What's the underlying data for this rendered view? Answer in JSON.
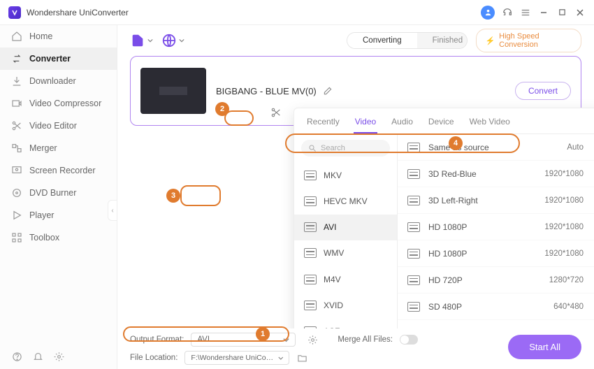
{
  "app": {
    "title": "Wondershare UniConverter"
  },
  "titlebar_icons": {
    "avatar": "user-icon",
    "headset": "support-icon",
    "menu": "menu-icon",
    "min": "minimize-icon",
    "max": "maximize-icon",
    "close": "close-icon"
  },
  "sidebar": {
    "items": [
      {
        "label": "Home",
        "name": "sidebar-item-home"
      },
      {
        "label": "Converter",
        "name": "sidebar-item-converter",
        "active": true
      },
      {
        "label": "Downloader",
        "name": "sidebar-item-downloader"
      },
      {
        "label": "Video Compressor",
        "name": "sidebar-item-video-compressor"
      },
      {
        "label": "Video Editor",
        "name": "sidebar-item-video-editor"
      },
      {
        "label": "Merger",
        "name": "sidebar-item-merger"
      },
      {
        "label": "Screen Recorder",
        "name": "sidebar-item-screen-recorder"
      },
      {
        "label": "DVD Burner",
        "name": "sidebar-item-dvd-burner"
      },
      {
        "label": "Player",
        "name": "sidebar-item-player"
      },
      {
        "label": "Toolbox",
        "name": "sidebar-item-toolbox"
      }
    ]
  },
  "toolbar": {
    "segmented": {
      "converting": "Converting",
      "finished": "Finished"
    },
    "high_speed": "High Speed Conversion"
  },
  "file": {
    "name": "BIGBANG - BLUE MV(0)",
    "convert_label": "Convert"
  },
  "popup": {
    "tabs": {
      "recently": "Recently",
      "video": "Video",
      "audio": "Audio",
      "device": "Device",
      "web": "Web Video"
    },
    "search_placeholder": "Search",
    "formats": [
      "MKV",
      "HEVC MKV",
      "AVI",
      "WMV",
      "M4V",
      "XVID",
      "ASF"
    ],
    "active_format_index": 2,
    "presets": [
      {
        "label": "Same as source",
        "res": "Auto"
      },
      {
        "label": "3D Red-Blue",
        "res": "1920*1080"
      },
      {
        "label": "3D Left-Right",
        "res": "1920*1080"
      },
      {
        "label": "HD 1080P",
        "res": "1920*1080"
      },
      {
        "label": "HD 1080P",
        "res": "1920*1080"
      },
      {
        "label": "HD 720P",
        "res": "1280*720"
      },
      {
        "label": "SD 480P",
        "res": "640*480"
      }
    ]
  },
  "footer": {
    "output_format_label": "Output Format:",
    "output_format_value": "AVI",
    "file_location_label": "File Location:",
    "file_location_value": "F:\\Wondershare UniConverter",
    "merge_label": "Merge All Files:",
    "start_all": "Start All"
  },
  "callouts": {
    "1": "1",
    "2": "2",
    "3": "3",
    "4": "4"
  }
}
